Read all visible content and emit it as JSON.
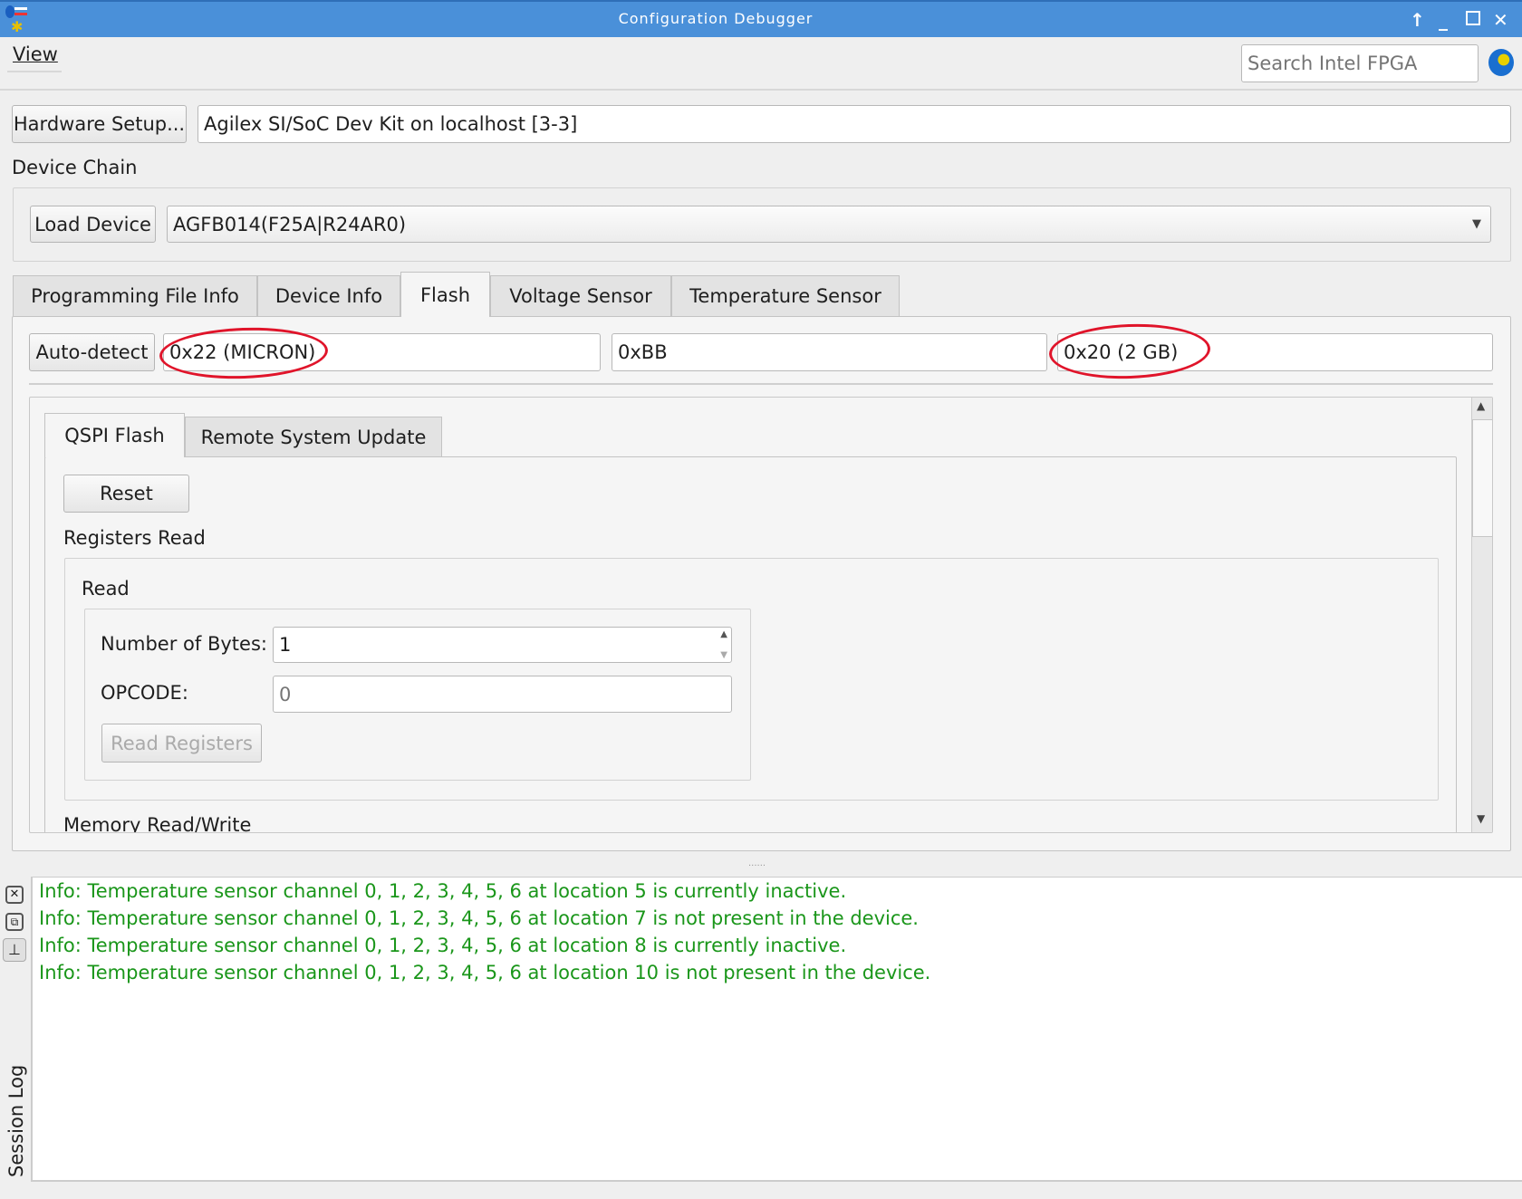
{
  "window": {
    "title": "Configuration Debugger"
  },
  "menu": {
    "view": "View"
  },
  "search": {
    "placeholder": "Search Intel FPGA"
  },
  "hardware": {
    "button": "Hardware Setup...",
    "value": "Agilex SI/SoC Dev Kit on localhost [3-3]"
  },
  "device_chain": {
    "label": "Device Chain",
    "load_button": "Load Device",
    "device": "AGFB014(F25A|R24AR0)"
  },
  "tabs": [
    "Programming File Info",
    "Device Info",
    "Flash",
    "Voltage Sensor",
    "Temperature Sensor"
  ],
  "flash": {
    "autodetect": "Auto-detect",
    "manufacturer": "0x22 (MICRON)",
    "type": "0xBB",
    "capacity": "0x20 (2 GB)",
    "subtabs": [
      "QSPI Flash",
      "Remote System Update"
    ],
    "reset": "Reset",
    "registers_read": "Registers Read",
    "read": "Read",
    "num_bytes_label": "Number of Bytes:",
    "num_bytes": "1",
    "opcode_label": "OPCODE:",
    "opcode_placeholder": "0",
    "read_registers": "Read Registers",
    "memory_rw": "Memory Read/Write"
  },
  "log": {
    "title": "Session Log",
    "lines": [
      "Info: Temperature sensor channel 0, 1, 2, 3, 4, 5, 6 at location 5 is currently inactive.",
      "Info: Temperature sensor channel 0, 1, 2, 3, 4, 5, 6 at location 7 is not present in the device.",
      "Info: Temperature sensor channel 0, 1, 2, 3, 4, 5, 6 at location 8 is currently inactive.",
      "Info: Temperature sensor channel 0, 1, 2, 3, 4, 5, 6 at location 10 is not present in the device."
    ]
  },
  "colors": {
    "titlebar": "#4a90d9",
    "log_text": "#1a961a",
    "annotation": "#e0142a"
  }
}
